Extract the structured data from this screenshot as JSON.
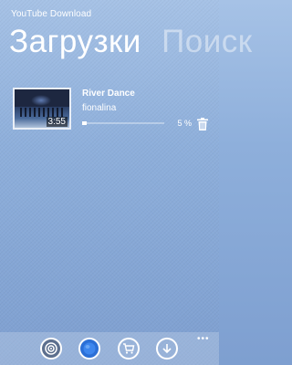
{
  "app": {
    "title": "YouTube Download"
  },
  "pivot": {
    "items": [
      "Загрузки",
      "Поиск"
    ]
  },
  "download": {
    "title": "River Dance",
    "author": "fionalina",
    "duration": "3:55",
    "progress_percent": 5,
    "progress_label": "5 %"
  },
  "appbar": {
    "buttons": [
      {
        "icon": "target-icon"
      },
      {
        "icon": "globe-icon"
      },
      {
        "icon": "cart-icon"
      },
      {
        "icon": "download-icon"
      }
    ],
    "more_label": "•••"
  },
  "colors": {
    "accent_button": "#2b6fd6",
    "background_top": "#a6c2e6",
    "background_bottom": "#7e9fd0"
  }
}
